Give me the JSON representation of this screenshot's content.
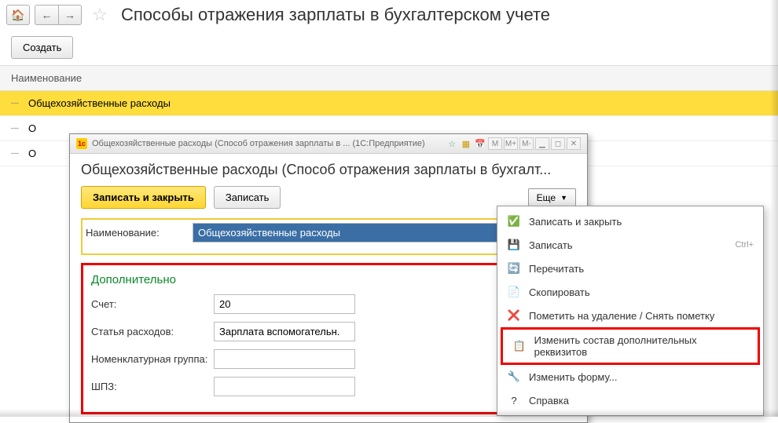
{
  "page": {
    "title": "Способы отражения зарплаты  в бухгалтерском учете",
    "create_btn": "Создать",
    "list_header": "Наименование",
    "rows": [
      {
        "label": "Общехозяйственные расходы",
        "selected": true
      },
      {
        "label": "О",
        "selected": false
      },
      {
        "label": "О",
        "selected": false
      }
    ]
  },
  "modal": {
    "window_title": "Общехозяйственные расходы (Способ отражения зарплаты  в ...  (1С:Предприятие)",
    "heading": "Общехозяйственные расходы (Способ отражения зарплаты  в бухгалт...",
    "save_close": "Записать и закрыть",
    "save": "Записать",
    "more": "Еще",
    "name_label": "Наименование:",
    "name_value": "Общехозяйственные расходы",
    "section": "Дополнительно",
    "fields": {
      "account_label": "Счет:",
      "account_value": "20",
      "cost_label": "Статья расходов:",
      "cost_value": "Зарплата вспомогательн.",
      "nomgroup_label": "Номенклатурная группа:",
      "nomgroup_value": "",
      "shpz_label": "ШПЗ:",
      "shpz_value": ""
    },
    "toolbar_marks": {
      "m": "M",
      "mplus": "M+",
      "mminus": "M-"
    }
  },
  "dropdown": {
    "items": [
      {
        "icon": "✅",
        "label": "Записать и закрыть",
        "name": "dd-save-close"
      },
      {
        "icon": "💾",
        "label": "Записать",
        "shortcut": "Ctrl+",
        "name": "dd-save"
      },
      {
        "icon": "🔄",
        "label": "Перечитать",
        "name": "dd-reread"
      },
      {
        "icon": "📄",
        "label": "Скопировать",
        "name": "dd-copy"
      },
      {
        "icon": "❌",
        "label": "Пометить на удаление / Снять пометку",
        "name": "dd-mark-delete"
      },
      {
        "icon": "📋",
        "label": "Изменить состав дополнительных реквизитов",
        "highlight": true,
        "name": "dd-change-attrs"
      },
      {
        "icon": "🔧",
        "label": "Изменить форму...",
        "name": "dd-change-form"
      },
      {
        "icon": "?",
        "label": "Справка",
        "name": "dd-help"
      }
    ]
  }
}
